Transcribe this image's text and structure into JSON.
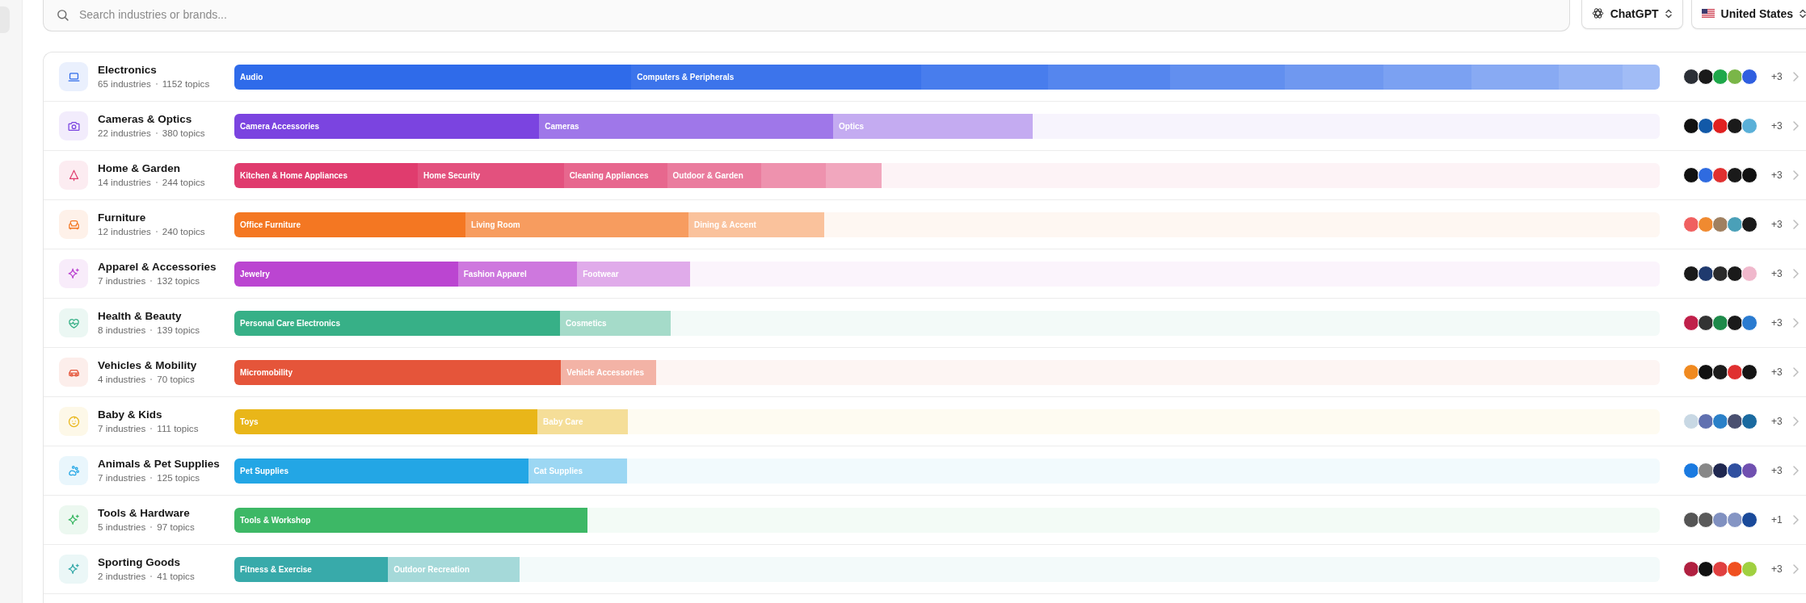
{
  "search": {
    "placeholder": "Search industries or brands..."
  },
  "model_selector": {
    "label": "ChatGPT"
  },
  "country_selector": {
    "label": "United States"
  },
  "categories": [
    {
      "name": "Electronics",
      "industries": "65 industries",
      "topics": "1152 topics",
      "color": "#2f6bea",
      "segments": [
        "Audio",
        "Computers & Peripherals"
      ],
      "logos": [
        {
          "color": "#2b2f36"
        },
        {
          "color": "#1a1a1a"
        },
        {
          "color": "#1fa84a"
        },
        {
          "color": "#7ab648"
        },
        {
          "color": "#2f5fe0"
        }
      ],
      "more": "+3"
    },
    {
      "name": "Cameras & Optics",
      "industries": "22 industries",
      "topics": "380 topics",
      "color": "#7b44e0",
      "segments": [
        "Camera Accessories",
        "Cameras",
        "Optics"
      ],
      "logos": [
        {
          "color": "#111111"
        },
        {
          "color": "#1259a8"
        },
        {
          "color": "#e02020"
        },
        {
          "color": "#1a1a1a"
        },
        {
          "color": "#5ab0d8"
        }
      ],
      "more": "+3"
    },
    {
      "name": "Home & Garden",
      "industries": "14 industries",
      "topics": "244 topics",
      "color": "#e03c6e",
      "segments": [
        "Kitchen & Home Appliances",
        "Home Security",
        "Cleaning Appliances",
        "Outdoor & Garden"
      ],
      "logos": [
        {
          "color": "#111111"
        },
        {
          "color": "#2f6be0"
        },
        {
          "color": "#e03030"
        },
        {
          "color": "#1a1a1a"
        },
        {
          "color": "#111111"
        }
      ],
      "more": "+3"
    },
    {
      "name": "Furniture",
      "industries": "12 industries",
      "topics": "240 topics",
      "color": "#f47722",
      "segments": [
        "Office Furniture",
        "Living Room",
        "Dining & Accent"
      ],
      "logos": [
        {
          "color": "#f06060"
        },
        {
          "color": "#f08a30"
        },
        {
          "color": "#a08060"
        },
        {
          "color": "#4aa0b8"
        },
        {
          "color": "#1a1a1a"
        }
      ],
      "more": "+3"
    },
    {
      "name": "Apparel & Accessories",
      "industries": "7 industries",
      "topics": "132 topics",
      "color": "#bb45d1",
      "segments": [
        "Jewelry",
        "Fashion Apparel",
        "Footwear"
      ],
      "logos": [
        {
          "color": "#1a1a1a"
        },
        {
          "color": "#1f3a6e"
        },
        {
          "color": "#2a2a2a"
        },
        {
          "color": "#1a1a1a"
        },
        {
          "color": "#f0b8cc"
        }
      ],
      "more": "+3"
    },
    {
      "name": "Health & Beauty",
      "industries": "8 industries",
      "topics": "139 topics",
      "color": "#37b087",
      "segments": [
        "Personal Care Electronics",
        "Cosmetics"
      ],
      "logos": [
        {
          "color": "#c0204a"
        },
        {
          "color": "#333333"
        },
        {
          "color": "#1e8a4a"
        },
        {
          "color": "#1a1a1a"
        },
        {
          "color": "#2a7bd0"
        }
      ],
      "more": "+3"
    },
    {
      "name": "Vehicles & Mobility",
      "industries": "4 industries",
      "topics": "70 topics",
      "color": "#e5553a",
      "segments": [
        "Micromobility",
        "Vehicle Accessories"
      ],
      "logos": [
        {
          "color": "#f08a20"
        },
        {
          "color": "#111111"
        },
        {
          "color": "#1c1c1c"
        },
        {
          "color": "#e03030"
        },
        {
          "color": "#151515"
        }
      ],
      "more": "+3"
    },
    {
      "name": "Baby & Kids",
      "industries": "7 industries",
      "topics": "111 topics",
      "color": "#e9b619",
      "segments": [
        "Toys",
        "Baby Care"
      ],
      "logos": [
        {
          "color": "#c8d8e4"
        },
        {
          "color": "#6070b0"
        },
        {
          "color": "#2a80c8"
        },
        {
          "color": "#4a5070"
        },
        {
          "color": "#1a6aa0"
        }
      ],
      "more": "+3"
    },
    {
      "name": "Animals & Pet Supplies",
      "industries": "7 industries",
      "topics": "125 topics",
      "color": "#23a6e5",
      "segments": [
        "Pet Supplies",
        "Cat Supplies"
      ],
      "logos": [
        {
          "color": "#1a7ae0"
        },
        {
          "color": "#888888"
        },
        {
          "color": "#202850"
        },
        {
          "color": "#3050a0"
        },
        {
          "color": "#7050b0"
        }
      ],
      "more": "+3"
    },
    {
      "name": "Tools & Hardware",
      "industries": "5 industries",
      "topics": "97 topics",
      "color": "#3db866",
      "segments": [
        "Tools & Workshop"
      ],
      "logos": [
        {
          "color": "#555555"
        },
        {
          "color": "#5a5a5a"
        },
        {
          "color": "#8090c0"
        },
        {
          "color": "#8595c4"
        },
        {
          "color": "#1a4a9a"
        }
      ],
      "more": "+1"
    },
    {
      "name": "Sporting Goods",
      "industries": "2 industries",
      "topics": "41 topics",
      "color": "#38aaaa",
      "segments": [
        "Fitness & Exercise",
        "Outdoor Recreation"
      ],
      "logos": [
        {
          "color": "#b02040"
        },
        {
          "color": "#111111"
        },
        {
          "color": "#e04040"
        },
        {
          "color": "#f05020"
        },
        {
          "color": "#a0d040"
        }
      ],
      "more": "+3"
    }
  ]
}
